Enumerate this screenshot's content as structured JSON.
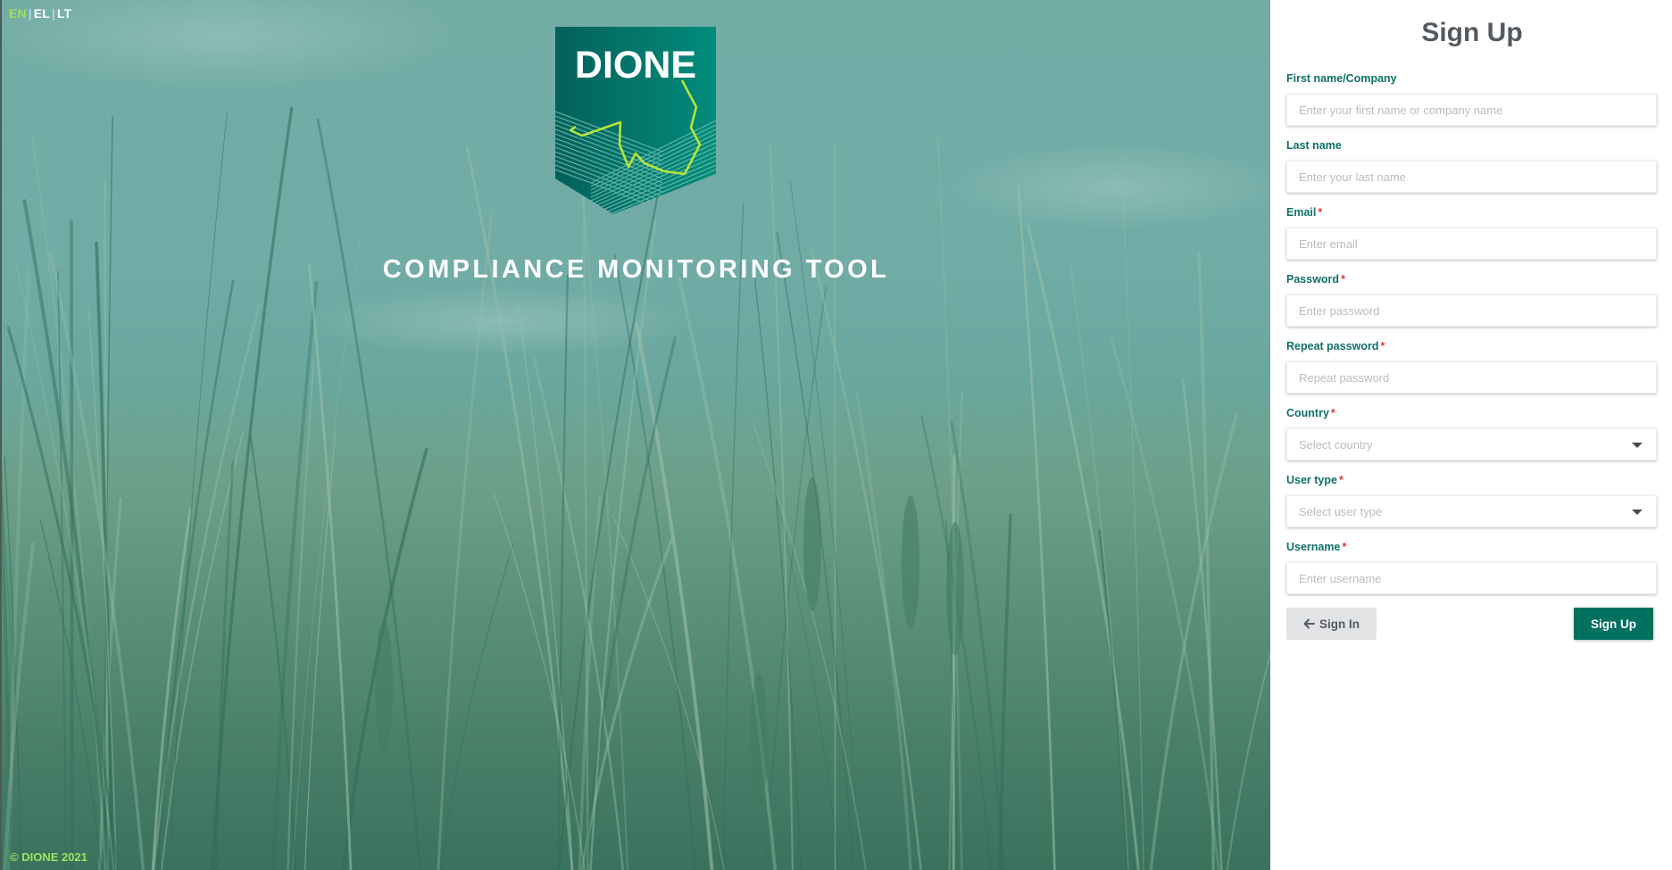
{
  "language_switcher": {
    "options": [
      "EN",
      "EL",
      "LT"
    ],
    "active": "EN",
    "separator": "|"
  },
  "brand": {
    "logo_text": "DIONE",
    "app_title": "COMPLIANCE MONITORING TOOL",
    "copyright": "© DIONE 2021",
    "colors": {
      "accent_green": "#9de25b",
      "primary_teal": "#00705f",
      "label_teal": "#10716a",
      "required_red": "#e53935"
    }
  },
  "signup_form": {
    "title": "Sign Up",
    "required_mark": "*",
    "fields": [
      {
        "label": "First name/Company",
        "required": false,
        "type": "text",
        "placeholder": "Enter your first name or company name",
        "value": ""
      },
      {
        "label": "Last name",
        "required": false,
        "type": "text",
        "placeholder": "Enter your last name",
        "value": ""
      },
      {
        "label": "Email",
        "required": true,
        "type": "email",
        "placeholder": "Enter email",
        "value": ""
      },
      {
        "label": "Password",
        "required": true,
        "type": "password",
        "placeholder": "Enter password",
        "value": ""
      },
      {
        "label": "Repeat password",
        "required": true,
        "type": "password",
        "placeholder": "Repeat password",
        "value": ""
      },
      {
        "label": "Country",
        "required": true,
        "type": "select",
        "placeholder": "Select country",
        "value": ""
      },
      {
        "label": "User type",
        "required": true,
        "type": "select",
        "placeholder": "Select user type",
        "value": ""
      },
      {
        "label": "Username",
        "required": true,
        "type": "text",
        "placeholder": "Enter username",
        "value": ""
      }
    ],
    "buttons": {
      "sign_in": {
        "label": "Sign In",
        "icon": "arrow-left-icon"
      },
      "sign_up": {
        "label": "Sign Up"
      }
    }
  }
}
